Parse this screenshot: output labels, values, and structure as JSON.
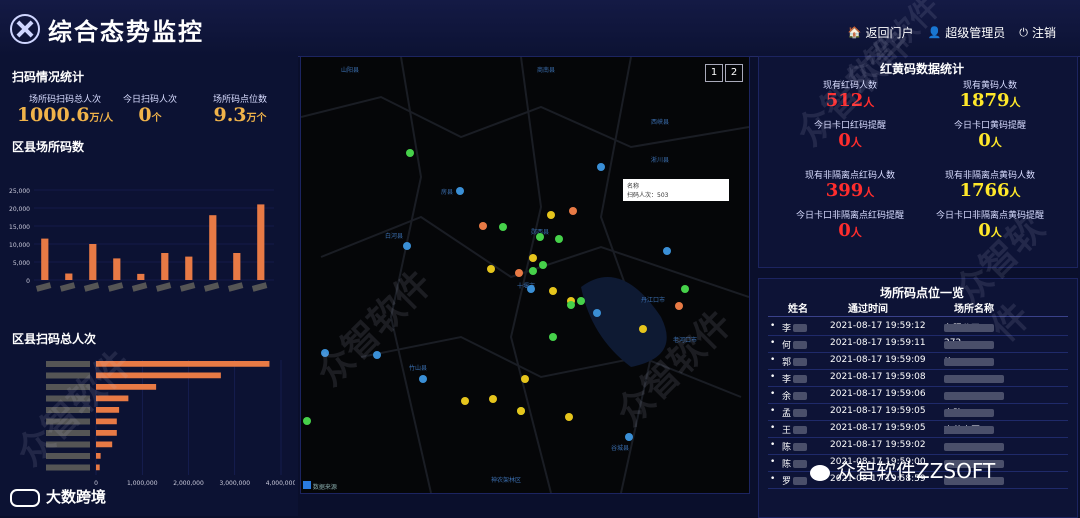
{
  "header": {
    "title": "综合态势监控",
    "nav": [
      {
        "icon": "home-icon",
        "glyph": "🏠",
        "label": "返回门户"
      },
      {
        "icon": "user-icon",
        "glyph": "👤",
        "label": "超级管理员"
      },
      {
        "icon": "power-icon",
        "glyph": "⏻",
        "label": "注销"
      }
    ]
  },
  "scan_stats": {
    "title": "扫码情况统计",
    "items": [
      {
        "label": "场所码扫码总人次",
        "value": "1000.6",
        "unit": "万/人"
      },
      {
        "label": "今日扫码人次",
        "value": "0",
        "unit": "个"
      },
      {
        "label": "场所码点位数",
        "value": "9.3",
        "unit": "万个"
      }
    ]
  },
  "district_codes": {
    "title": "区县场所码数",
    "y_ticks": [
      "25,000",
      "20,000",
      "15,000",
      "10,000",
      "5,000",
      "0"
    ]
  },
  "district_scans": {
    "title": "区县扫码总人次",
    "x_ticks": [
      "0",
      "1,000,000",
      "2,000,000",
      "3,000,000",
      "4,000,000"
    ]
  },
  "chart_data": [
    {
      "type": "bar",
      "title": "区县场所码数",
      "values": [
        11500,
        1800,
        10000,
        6000,
        1700,
        7500,
        6500,
        18000,
        7500,
        21000
      ],
      "ylim": [
        0,
        25000
      ]
    },
    {
      "type": "bar",
      "orientation": "horizontal",
      "title": "区县扫码总人次",
      "values": [
        3750000,
        2700000,
        1300000,
        700000,
        500000,
        450000,
        450000,
        350000,
        100000,
        80000
      ],
      "xlim": [
        0,
        4000000
      ]
    }
  ],
  "map": {
    "buttons": [
      "1",
      "2"
    ],
    "tooltip": {
      "name": "名称",
      "count": "扫码人次：503"
    },
    "place_labels": [
      "山阳县",
      "商南县",
      "西峡县",
      "淅川县",
      "白河县",
      "丹江口市",
      "老河口市",
      "竹山县",
      "房县",
      "谷城县",
      "神农架林区",
      "十堰市",
      "郧西县"
    ],
    "copyright": "数据来源"
  },
  "health_stats": {
    "title": "红黄码数据统计",
    "items": [
      {
        "label": "现有红码人数",
        "value": "512",
        "unit": "人",
        "color": "red"
      },
      {
        "label": "现有黄码人数",
        "value": "1879",
        "unit": "人",
        "color": "yellow"
      },
      {
        "label": "今日卡口红码提醒",
        "value": "0",
        "unit": "人",
        "color": "red"
      },
      {
        "label": "今日卡口黄码提醒",
        "value": "0",
        "unit": "人",
        "color": "yellow"
      },
      {
        "label": "现有非隔离点红码人数",
        "value": "399",
        "unit": "人",
        "color": "red"
      },
      {
        "label": "现有非隔离点黄码人数",
        "value": "1766",
        "unit": "人",
        "color": "yellow"
      },
      {
        "label": "今日卡口非隔离点红码提醒",
        "value": "0",
        "unit": "人",
        "color": "red"
      },
      {
        "label": "今日卡口非隔离点黄码提醒",
        "value": "0",
        "unit": "人",
        "color": "yellow"
      }
    ]
  },
  "place_list": {
    "title": "场所码点位一览",
    "headers": [
      "姓名",
      "通过时间",
      "场所名称"
    ],
    "rows": [
      {
        "name": "李",
        "time": "2021-08-17 19:59:12",
        "place": "有限公司..."
      },
      {
        "name": "何",
        "time": "2021-08-17 19:59:11",
        "place": "272"
      },
      {
        "name": "郭",
        "time": "2021-08-17 19:59:09",
        "place": "栋"
      },
      {
        "name": "李",
        "time": "2021-08-17 19:59:08",
        "place": ""
      },
      {
        "name": "余",
        "time": "2021-08-17 19:59:06",
        "place": ""
      },
      {
        "name": "孟",
        "time": "2021-08-17 19:59:05",
        "place": "大队"
      },
      {
        "name": "王",
        "time": "2021-08-17 19:59:05",
        "place": "嘉苑小区"
      },
      {
        "name": "陈",
        "time": "2021-08-17 19:59:02",
        "place": ""
      },
      {
        "name": "陈",
        "time": "2021-08-17 19:59:00",
        "place": ""
      },
      {
        "name": "罗",
        "time": "2021-08-17 19:58:59",
        "place": ""
      }
    ]
  },
  "watermark": {
    "text": "众智软件",
    "brand": "众智软件ZZSOFT",
    "bottom_logo": "大数跨境"
  },
  "colors": {
    "bar": "#e87a45",
    "red": "#ff2d2d",
    "yellow": "#ffe82a",
    "accent": "#f0b34a"
  }
}
